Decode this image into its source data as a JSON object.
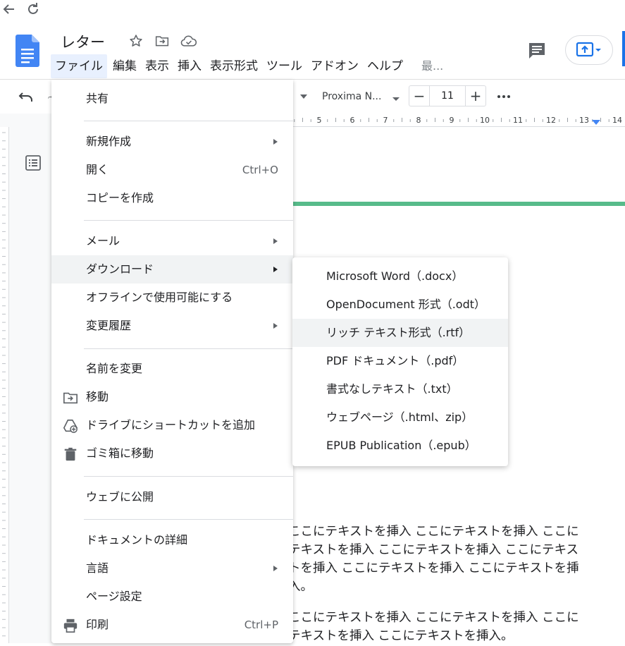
{
  "browser": {
    "back_icon": "arrow-left-icon",
    "reload_icon": "reload-icon"
  },
  "doc": {
    "title": "レター"
  },
  "menubar": {
    "items": [
      "ファイル",
      "編集",
      "表示",
      "挿入",
      "表示形式",
      "ツール",
      "アドオン",
      "ヘルプ",
      "最..."
    ]
  },
  "toolbar": {
    "font_name": "Proxima N...",
    "font_size": "11",
    "minus": "−",
    "plus": "+",
    "more": "•••"
  },
  "ruler": {
    "ticks": [
      "5",
      "6",
      "7",
      "8",
      "9",
      "10",
      "11",
      "12",
      "13",
      "14"
    ]
  },
  "file_menu": {
    "items": [
      {
        "label": "共有"
      },
      {
        "label": "新規作成",
        "has_submenu": true
      },
      {
        "label": "開く",
        "shortcut": "Ctrl+O"
      },
      {
        "label": "コピーを作成"
      },
      {
        "label": "メール",
        "has_submenu": true
      },
      {
        "label": "ダウンロード",
        "has_submenu": true,
        "highlighted": true
      },
      {
        "label": "オフラインで使用可能にする"
      },
      {
        "label": "変更履歴",
        "has_submenu": true
      },
      {
        "label": "名前を変更"
      },
      {
        "label": "移動",
        "icon": "folder-move-icon"
      },
      {
        "label": "ドライブにショートカットを追加",
        "icon": "drive-add-shortcut-icon"
      },
      {
        "label": "ゴミ箱に移動",
        "icon": "trash-icon"
      },
      {
        "label": "ウェブに公開"
      },
      {
        "label": "ドキュメントの詳細"
      },
      {
        "label": "言語",
        "has_submenu": true
      },
      {
        "label": "ページ設定"
      },
      {
        "label": "印刷",
        "shortcut": "Ctrl+P",
        "icon": "printer-icon"
      }
    ]
  },
  "download_submenu": {
    "items": [
      {
        "label": "Microsoft Word（.docx）"
      },
      {
        "label": "OpenDocument 形式（.odt）"
      },
      {
        "label": "リッチ テキスト形式（.rtf）",
        "highlighted": true
      },
      {
        "label": "PDF ドキュメント（.pdf）"
      },
      {
        "label": "書式なしテキスト（.txt）"
      },
      {
        "label": "ウェブページ（.html、zip）"
      },
      {
        "label": "EPUB Publication（.epub）"
      }
    ]
  },
  "body_text": {
    "lines": [
      "ここにテキストを挿入 ここにテキストを挿入 ここに",
      "テキストを挿入 ここにテキストを挿入 ここにテキス",
      "トを挿入 ここにテキストを挿入 ここにテキストを挿",
      "入。",
      "ここにテキストを挿入 ここにテキストを挿入 ここに",
      "テキストを挿入 ここにテキストを挿入。"
    ]
  },
  "colors": {
    "accent": "#1a73e8",
    "menu_highlight": "#f1f3f4",
    "active_menu": "#e8f0fe",
    "green_rule": "#57bb8a"
  }
}
